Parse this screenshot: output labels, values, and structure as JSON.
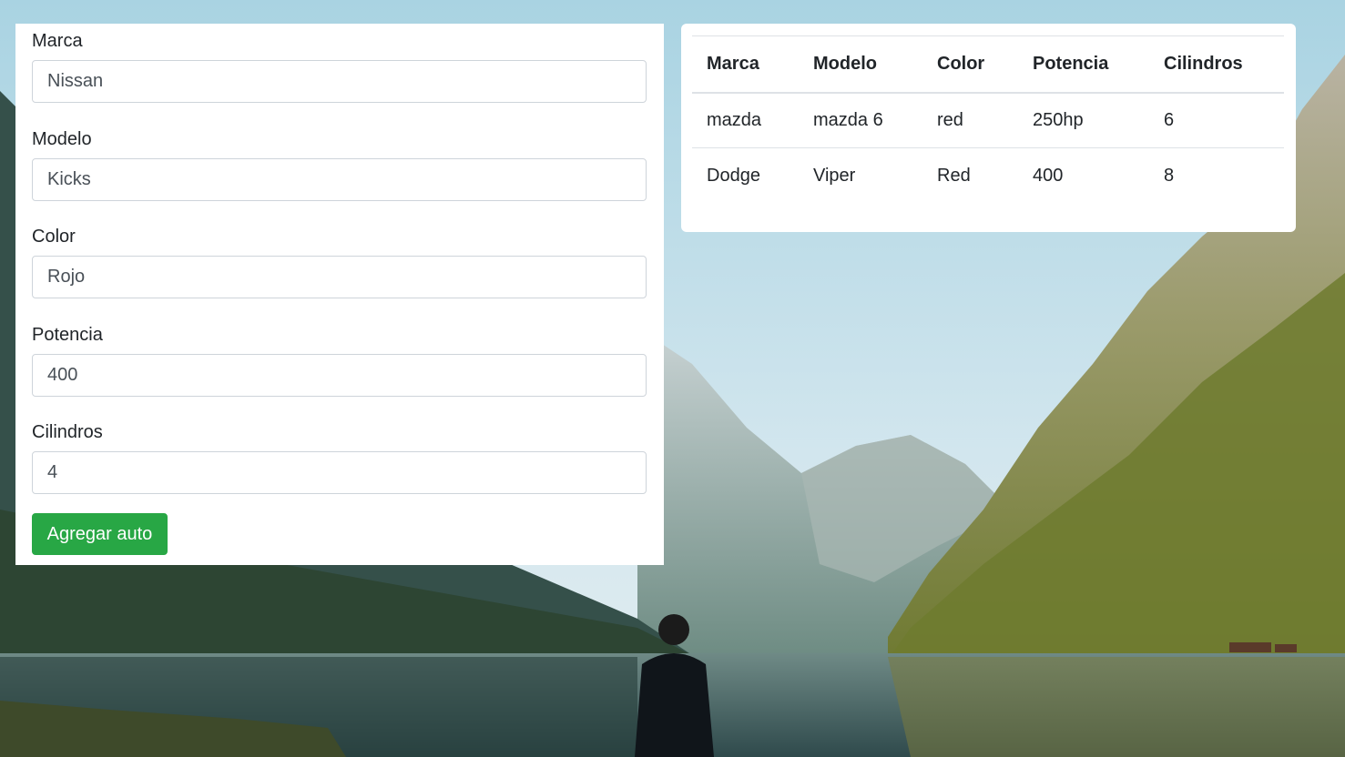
{
  "form": {
    "fields": [
      {
        "label": "Marca",
        "value": "Nissan"
      },
      {
        "label": "Modelo",
        "value": "Kicks"
      },
      {
        "label": "Color",
        "value": "Rojo"
      },
      {
        "label": "Potencia",
        "value": "400"
      },
      {
        "label": "Cilindros",
        "value": "4"
      }
    ],
    "submit_label": "Agregar auto"
  },
  "table": {
    "headers": [
      "Marca",
      "Modelo",
      "Color",
      "Potencia",
      "Cilindros"
    ],
    "rows": [
      [
        "mazda",
        "mazda 6",
        "red",
        "250hp",
        "6"
      ],
      [
        "Dodge",
        "Viper",
        "Red",
        "400",
        "8"
      ]
    ]
  },
  "colors": {
    "button": "#28a745",
    "card": "#ffffff",
    "input_border": "#ced4da",
    "table_border": "#dee2e6"
  }
}
